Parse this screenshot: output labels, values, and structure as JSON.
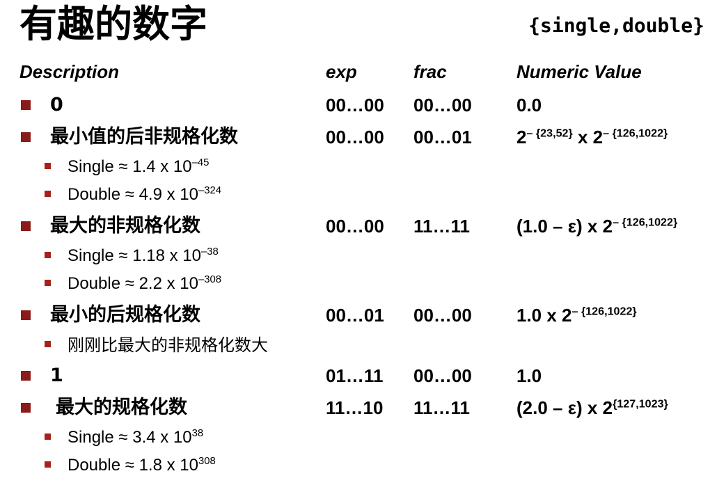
{
  "title": "有趣的数字",
  "title_right": "{single,double}",
  "headers": {
    "description": "Description",
    "exp": "exp",
    "frac": "frac",
    "value": "Numeric Value"
  },
  "rows": [
    {
      "desc": "0",
      "exp": "00…00",
      "frac": "00…00",
      "val_base": "0.0",
      "val_exp": "",
      "val_mid": "",
      "val_base2": "",
      "val_exp2": ""
    },
    {
      "desc": "最小值的后非规格化数",
      "exp": "00…00",
      "frac": "00…01",
      "val_base": "2",
      "val_exp": "– {23,52}",
      "val_mid": " x 2",
      "val_base2": "",
      "val_exp2": "– {126,1022}"
    },
    {
      "desc": "最大的非规格化数",
      "exp": "00…00",
      "frac": "11…11",
      "val_base": "(1.0 – ε) x 2",
      "val_exp": "– {126,1022}",
      "val_mid": "",
      "val_base2": "",
      "val_exp2": ""
    },
    {
      "desc": "最小的后规格化数",
      "exp": "00…01",
      "frac": "00…00",
      "val_base": "1.0 x 2",
      "val_exp": "– {126,1022}",
      "val_mid": "",
      "val_base2": "",
      "val_exp2": ""
    },
    {
      "desc": "1",
      "exp": "01…11",
      "frac": "00…00",
      "val_base": "1.0",
      "val_exp": "",
      "val_mid": "",
      "val_base2": "",
      "val_exp2": ""
    },
    {
      "desc": "最大的规格化数",
      "exp": "11…10",
      "frac": "11…11",
      "val_base": "(2.0 – ε) x 2",
      "val_exp": "{127,1023}",
      "val_mid": "",
      "val_base2": "",
      "val_exp2": ""
    }
  ],
  "subs": [
    {
      "base": "Single ≈ 1.4 x 10",
      "exp": "–45"
    },
    {
      "base": "Double ≈ 4.9 x 10",
      "exp": "–324"
    },
    {
      "base": "Single ≈ 1.18 x 10",
      "exp": "–38"
    },
    {
      "base": "Double ≈ 2.2 x 10",
      "exp": "–308"
    },
    {
      "base": "刚刚比最大的非规格化数大",
      "exp": ""
    },
    {
      "base": "Single ≈ 3.4 x 10",
      "exp": "38"
    },
    {
      "base": "Double ≈ 1.8 x 10",
      "exp": "308"
    }
  ]
}
